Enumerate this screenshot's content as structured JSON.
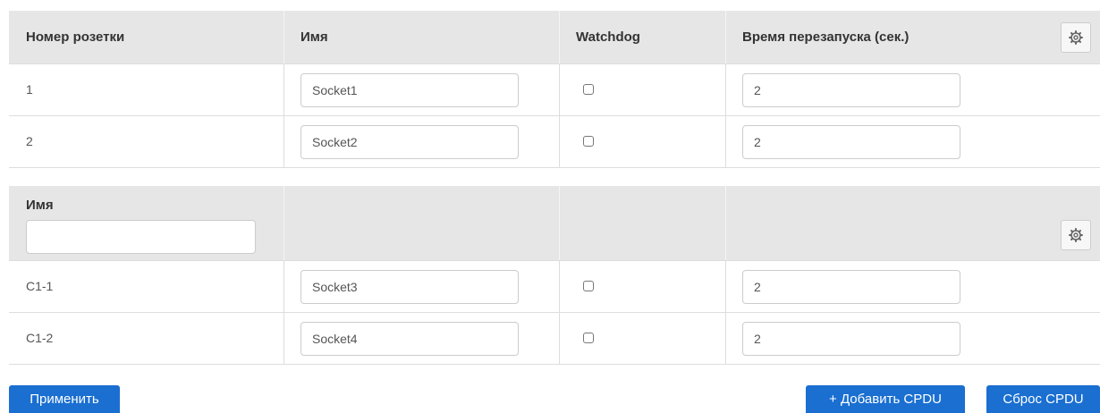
{
  "table1": {
    "headers": {
      "socket_number": "Номер розетки",
      "name": "Имя",
      "watchdog": "Watchdog",
      "restart_time": "Время перезапуска (сек.)"
    },
    "rows": [
      {
        "number": "1",
        "name": "Socket1",
        "watchdog": false,
        "restart_time": "2"
      },
      {
        "number": "2",
        "name": "Socket2",
        "watchdog": false,
        "restart_time": "2"
      }
    ]
  },
  "table2": {
    "header": {
      "name_label": "Имя",
      "filter_value": ""
    },
    "rows": [
      {
        "number": "C1-1",
        "name": "Socket3",
        "watchdog": false,
        "restart_time": "2"
      },
      {
        "number": "C1-2",
        "name": "Socket4",
        "watchdog": false,
        "restart_time": "2"
      }
    ]
  },
  "buttons": {
    "apply": "Применить",
    "add_cpdu": "+ Добавить CPDU",
    "reset_cpdu": "Сброс CPDU"
  },
  "icons": {
    "settings": "gear-icon"
  },
  "colors": {
    "header_bg": "#e6e6e6",
    "button_bg": "#1a6fd1",
    "border": "#dddddd"
  }
}
